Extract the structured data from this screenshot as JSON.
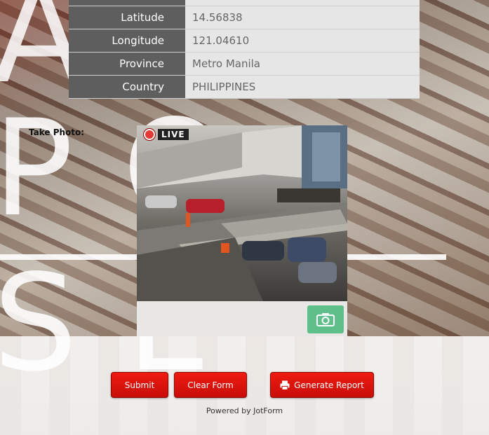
{
  "location": {
    "rows": [
      {
        "label": "Latitude",
        "value": "14.56838"
      },
      {
        "label": "Longitude",
        "value": "121.04610"
      },
      {
        "label": "Province",
        "value": "Metro Manila"
      },
      {
        "label": "Country",
        "value": "PHILIPPINES"
      }
    ]
  },
  "photo": {
    "label": "Take Photo:",
    "live_badge": "LIVE",
    "capture_icon": "camera-icon"
  },
  "actions": {
    "submit": "Submit",
    "clear": "Clear Form",
    "report": "Generate Report",
    "report_icon": "printer-icon"
  },
  "footer": {
    "powered_by": "Powered by JotForm"
  },
  "colors": {
    "button_red": "#e0140d",
    "capture_green": "#5fbf8a",
    "label_cell": "#5e5e5e",
    "value_cell": "#e6e6e6"
  }
}
